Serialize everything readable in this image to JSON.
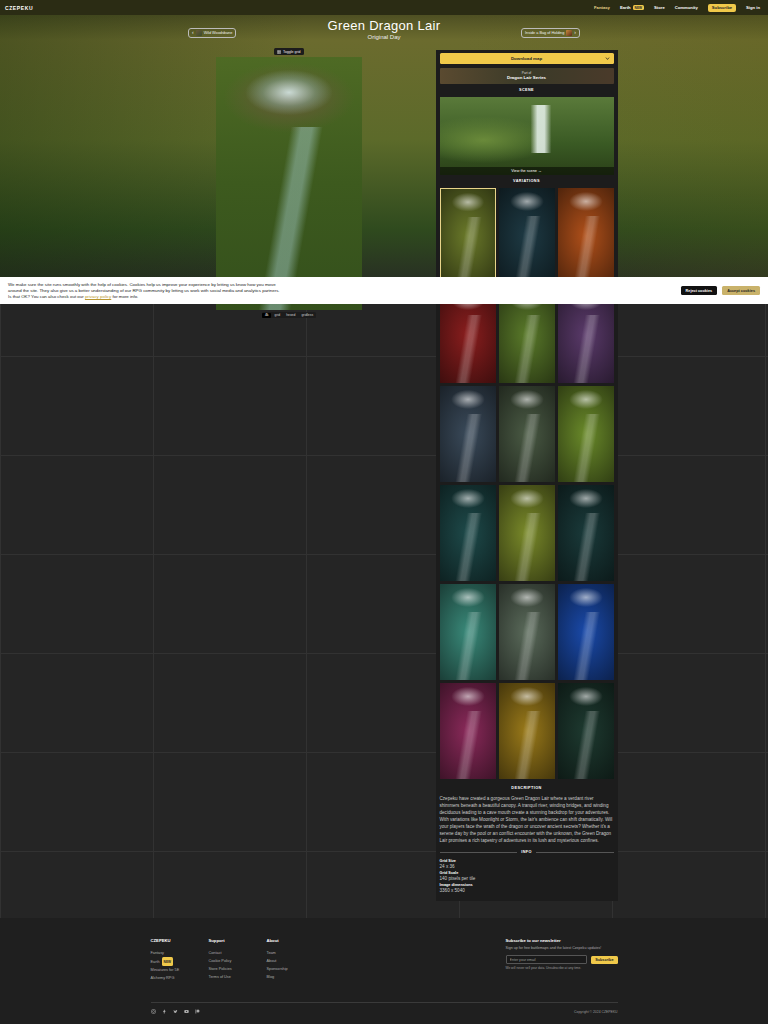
{
  "header": {
    "logo": "CZEPEKU",
    "nav": [
      {
        "label": "Fantasy",
        "selected": true,
        "badge": ""
      },
      {
        "label": "Earth",
        "selected": false,
        "badge": "NEW"
      },
      {
        "label": "Store",
        "selected": false,
        "badge": ""
      },
      {
        "label": "Community",
        "selected": false,
        "badge": ""
      }
    ],
    "subscribe": "Subscribe",
    "sign_in": "Sign in"
  },
  "title": "Green Dragon Lair",
  "subtitle": "Original Day",
  "prev": {
    "arrow": "‹",
    "label": "Wild Woodsbane"
  },
  "next": {
    "arrow": "›",
    "label": "Inside a Bag of Holding"
  },
  "map": {
    "toggle": "Toggle grid",
    "options": [
      {
        "label": "4k",
        "selected": true
      },
      {
        "label": "grid",
        "selected": false
      },
      {
        "label": "hexed",
        "selected": false
      },
      {
        "label": "gridless",
        "selected": false
      }
    ]
  },
  "panel": {
    "download": "Download map",
    "series": {
      "label": "Part of",
      "name": "Dragon Lair Series"
    },
    "scene_heading": "SCENE",
    "scene_link": "View the scene →",
    "variations_heading": "VARIATIONS",
    "variations": [
      {
        "color": "#6b7a2a",
        "selected": true
      },
      {
        "color": "#1e3a44",
        "selected": false
      },
      {
        "color": "#b0501a",
        "selected": false
      },
      {
        "color": "#8a1e1e",
        "selected": false
      },
      {
        "color": "#5a7a2a",
        "selected": false
      },
      {
        "color": "#5a3a6a",
        "selected": false
      },
      {
        "color": "#3a4a5a",
        "selected": false
      },
      {
        "color": "#4a5a44",
        "selected": false
      },
      {
        "color": "#6a8a2a",
        "selected": false
      },
      {
        "color": "#1e4a4a",
        "selected": false
      },
      {
        "color": "#7a8a2a",
        "selected": false
      },
      {
        "color": "#1a3a3a",
        "selected": false
      },
      {
        "color": "#3a8a7a",
        "selected": false
      },
      {
        "color": "#5a6a5a",
        "selected": false
      },
      {
        "color": "#1a4aaa",
        "selected": false
      },
      {
        "color": "#8a2a5a",
        "selected": false
      },
      {
        "color": "#9a7a1a",
        "selected": false
      },
      {
        "color": "#1e3a30",
        "selected": false
      }
    ],
    "description_heading": "DESCRIPTION",
    "description": "Czepeku have created a gorgeous Green Dragon Lair where a verdant river shimmers beneath a beautiful canopy. A tranquil river, winding bridges, and winding deciduous leading to a cave mouth create a stunning backdrop for your adventures. With variations like Moonlight or Storm, the lair's ambience can shift dramatically. Will your players face the wrath of the dragon or uncover ancient secrets? Whether it's a serene day by the pool or an conflict encounter with the unknown, the Green Dragon Lair promises a rich tapestry of adventures in its lush and mysterious confines.",
    "info_heading": "INFO",
    "info": [
      {
        "label": "Grid Size",
        "value": "24 x 36"
      },
      {
        "label": "Grid Scale",
        "value": "140 pixels per tile"
      },
      {
        "label": "Image dimensions",
        "value": "3360 x 5040"
      }
    ]
  },
  "cookie": {
    "text_before": "We make sure the site runs smoothly with the help of cookies. Cookies help us improve your experience by letting us know how you move around the site. They also give us a better understanding of our RPG community by letting us work with social media and analytics partners. Is that OK? You can also check out our ",
    "link": "privacy policy",
    "text_after": " for more info.",
    "reject": "Reject cookies",
    "accept": "Accept cookies"
  },
  "footer": {
    "columns": [
      {
        "heading": "CZEPEKU",
        "links": [
          {
            "label": "Fantasy",
            "badge": ""
          },
          {
            "label": "Earth",
            "badge": "NEW"
          },
          {
            "label": "Miniatures for 5E",
            "badge": ""
          },
          {
            "label": "Alchemy RPG",
            "badge": ""
          }
        ]
      },
      {
        "heading": "Support",
        "links": [
          {
            "label": "Contact",
            "badge": ""
          },
          {
            "label": "Cookie Policy",
            "badge": ""
          },
          {
            "label": "Store Policies",
            "badge": ""
          },
          {
            "label": "Terms of Use",
            "badge": ""
          }
        ]
      },
      {
        "heading": "About",
        "links": [
          {
            "label": "Team",
            "badge": ""
          },
          {
            "label": "About",
            "badge": ""
          },
          {
            "label": "Sponsorship",
            "badge": ""
          },
          {
            "label": "Blog",
            "badge": ""
          }
        ]
      }
    ],
    "newsletter": {
      "heading": "Subscribe to our newsletter",
      "text": "Sign up for free battlemaps and the latest Czepeku updates!",
      "placeholder": "Enter your email",
      "button": "Subscribe",
      "note": "We will never sell your data. Unsubscribe at any time."
    },
    "copyright": "Copyright © 2024 CZEPEKU"
  }
}
